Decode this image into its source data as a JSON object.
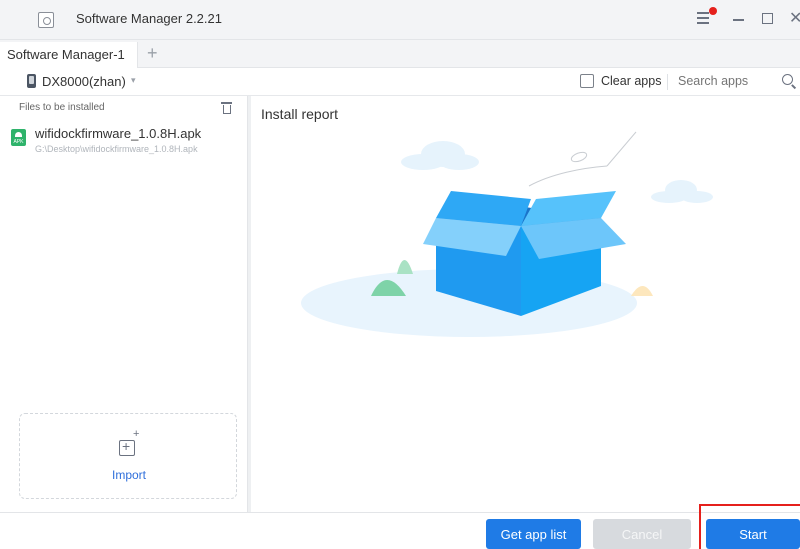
{
  "window": {
    "title": "Software Manager 2.2.21",
    "notification_color": "#e5201c"
  },
  "tabs": {
    "active_label": "Software Manager-1",
    "add_label": "+"
  },
  "device": {
    "name": "DX8000(zhan)",
    "chevron": "▾"
  },
  "toolbar": {
    "clear_apps_label": "Clear apps",
    "clear_apps_checked": false,
    "search_placeholder": "Search apps"
  },
  "left_panel": {
    "files_label": "Files to be installed",
    "files": [
      {
        "name": "wifidockfirmware_1.0.8H.apk",
        "path": "G:\\Desktop\\wifidockfirmware_1.0.8H.apk",
        "icon": "apk-icon",
        "icon_text": "APK"
      }
    ],
    "import_label": "Import"
  },
  "right_panel": {
    "report_title": "Install report"
  },
  "buttons": {
    "get_app_list": "Get app list",
    "cancel": "Cancel",
    "start": "Start"
  },
  "colors": {
    "primary": "#1f7be6",
    "disabled": "#d7dade",
    "highlight": "#e5201c"
  }
}
